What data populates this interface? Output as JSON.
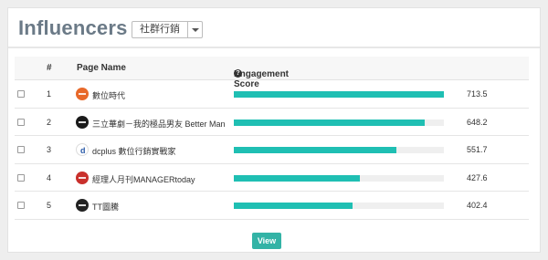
{
  "header": {
    "title": "Influencers",
    "category_select": {
      "value": "社群行銷"
    }
  },
  "table": {
    "columns": {
      "rank": "#",
      "page_name": "Page Name",
      "engagement_score": "Engagement Score"
    },
    "max_score": 713.5,
    "rows": [
      {
        "rank": "1",
        "page_name": "數位時代",
        "score": "713.5",
        "score_value": 713.5,
        "avatar_icon": "digital-age-logo-icon",
        "avatar_color": "#e8692a"
      },
      {
        "rank": "2",
        "page_name": "三立華劇－我的極品男友 Better Man",
        "score": "648.2",
        "score_value": 648.2,
        "avatar_icon": "better-man-logo-icon",
        "avatar_color": "#1a1a1a"
      },
      {
        "rank": "3",
        "page_name": "dcplus 數位行銷實戰家",
        "score": "551.7",
        "score_value": 551.7,
        "avatar_icon": "dcplus-logo-icon",
        "avatar_color": "#ffffff"
      },
      {
        "rank": "4",
        "page_name": "經理人月刊MANAGERtoday",
        "score": "427.6",
        "score_value": 427.6,
        "avatar_icon": "manager-today-logo-icon",
        "avatar_color": "#c9302c"
      },
      {
        "rank": "5",
        "page_name": "TT圖騰",
        "score": "402.4",
        "score_value": 402.4,
        "avatar_icon": "tt-totem-logo-icon",
        "avatar_color": "#222222"
      }
    ]
  },
  "actions": {
    "view_label": "View"
  },
  "colors": {
    "bar_fill": "#1fbfb3",
    "bar_track": "#efefef",
    "view_button": "#33b3a6",
    "title": "#6b7a87"
  }
}
